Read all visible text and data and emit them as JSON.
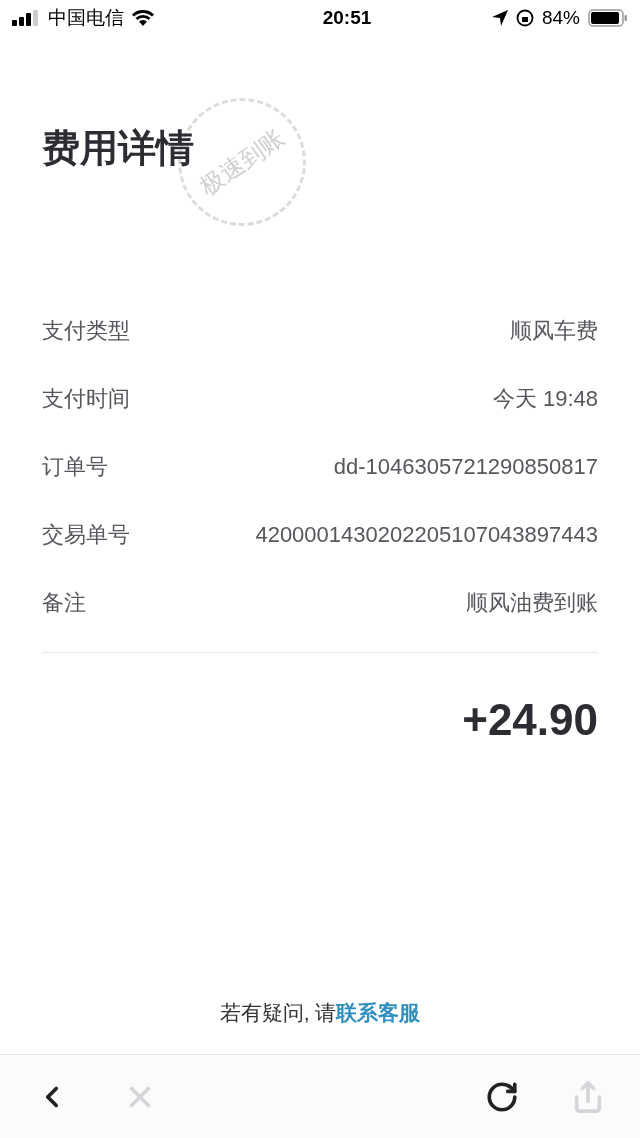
{
  "status_bar": {
    "carrier": "中国电信",
    "time": "20:51",
    "battery": "84%"
  },
  "title": "费用详情",
  "stamp": "极速到账",
  "details": [
    {
      "label": "支付类型",
      "value": "顺风车费"
    },
    {
      "label": "支付时间",
      "value": "今天 19:48"
    },
    {
      "label": "订单号",
      "value": "dd-1046305721290850817"
    },
    {
      "label": "交易单号",
      "value": "4200001430202205107043897443"
    },
    {
      "label": "备注",
      "value": "顺风油费到账"
    }
  ],
  "amount": "+24.90",
  "help": {
    "text": "若有疑问, 请",
    "link": "联系客服"
  },
  "toolbar": [
    {
      "kind": "back",
      "disabled": false
    },
    {
      "kind": "close",
      "disabled": true
    },
    {
      "kind": "refresh",
      "disabled": false
    },
    {
      "kind": "share",
      "disabled": true
    }
  ]
}
